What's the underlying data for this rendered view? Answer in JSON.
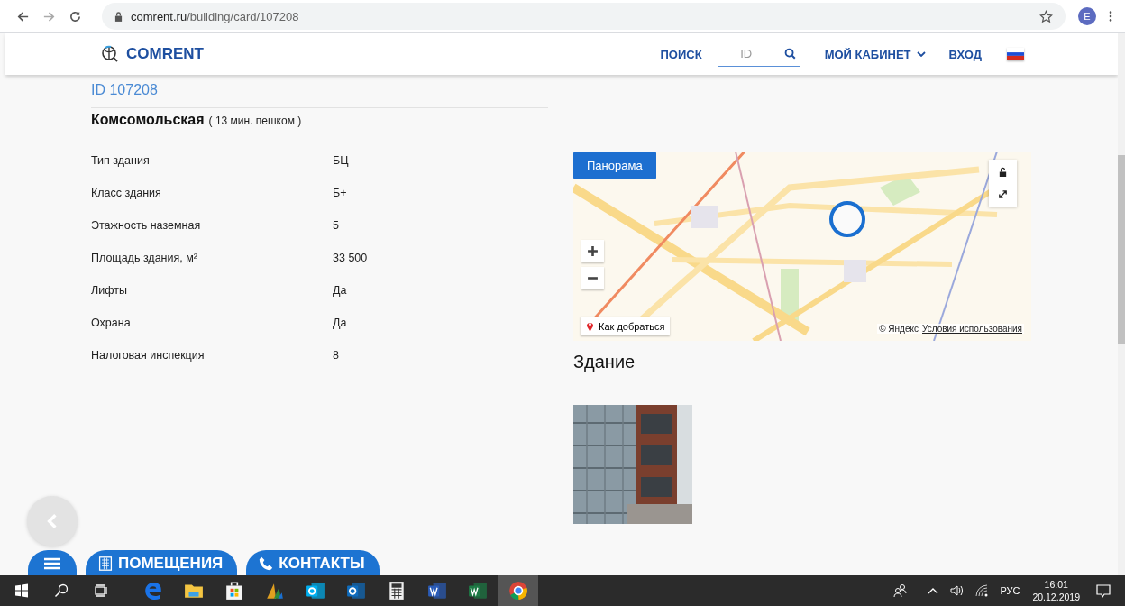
{
  "browser": {
    "url_host": "comrent.ru",
    "url_path": "/building/card/107208",
    "profile_initial": "E"
  },
  "header": {
    "logo": "COMRENT",
    "search_label": "ПОИСК",
    "search": {
      "placeholder": "ID"
    },
    "account": "МОЙ КАБИНЕТ",
    "login": "ВХОД"
  },
  "building": {
    "id": "ID 107208",
    "metro": "Комсомольская",
    "walk": "( 13 мин. пешком )",
    "properties": [
      {
        "label": "Тип здания",
        "value": "БЦ"
      },
      {
        "label": "Класс здания",
        "value": "Б+"
      },
      {
        "label": "Этажность наземная",
        "value": "5"
      },
      {
        "label": "Площадь здания, м²",
        "value": "33 500"
      },
      {
        "label": "Лифты",
        "value": "Да"
      },
      {
        "label": "Охрана",
        "value": "Да"
      },
      {
        "label": "Налоговая инспекция",
        "value": "8"
      }
    ]
  },
  "map": {
    "panorama_button": "Панорама",
    "route_button": "Как добраться",
    "copyright": "© Яндекс",
    "terms_link": "Условия использования"
  },
  "gallery": {
    "title": "Здание"
  },
  "floating_buttons": [
    {
      "kind": "menu"
    },
    {
      "kind": "rooms",
      "label": "ПОМЕЩЕНИЯ"
    },
    {
      "kind": "contacts",
      "label": "КОНТАКТЫ"
    }
  ],
  "taskbar": {
    "apps": [
      {
        "kind": "edge",
        "selected": false
      },
      {
        "kind": "folder",
        "selected": false
      },
      {
        "kind": "store",
        "selected": false
      },
      {
        "kind": "chart",
        "selected": false
      },
      {
        "kind": "skype",
        "selected": false
      },
      {
        "kind": "outlook",
        "selected": false
      },
      {
        "kind": "calculator",
        "selected": false
      },
      {
        "kind": "word",
        "selected": false
      },
      {
        "kind": "excel",
        "selected": false
      },
      {
        "kind": "chrome",
        "selected": true
      }
    ],
    "language": "РУС",
    "time": "16:01",
    "date": "20.12.2019"
  }
}
